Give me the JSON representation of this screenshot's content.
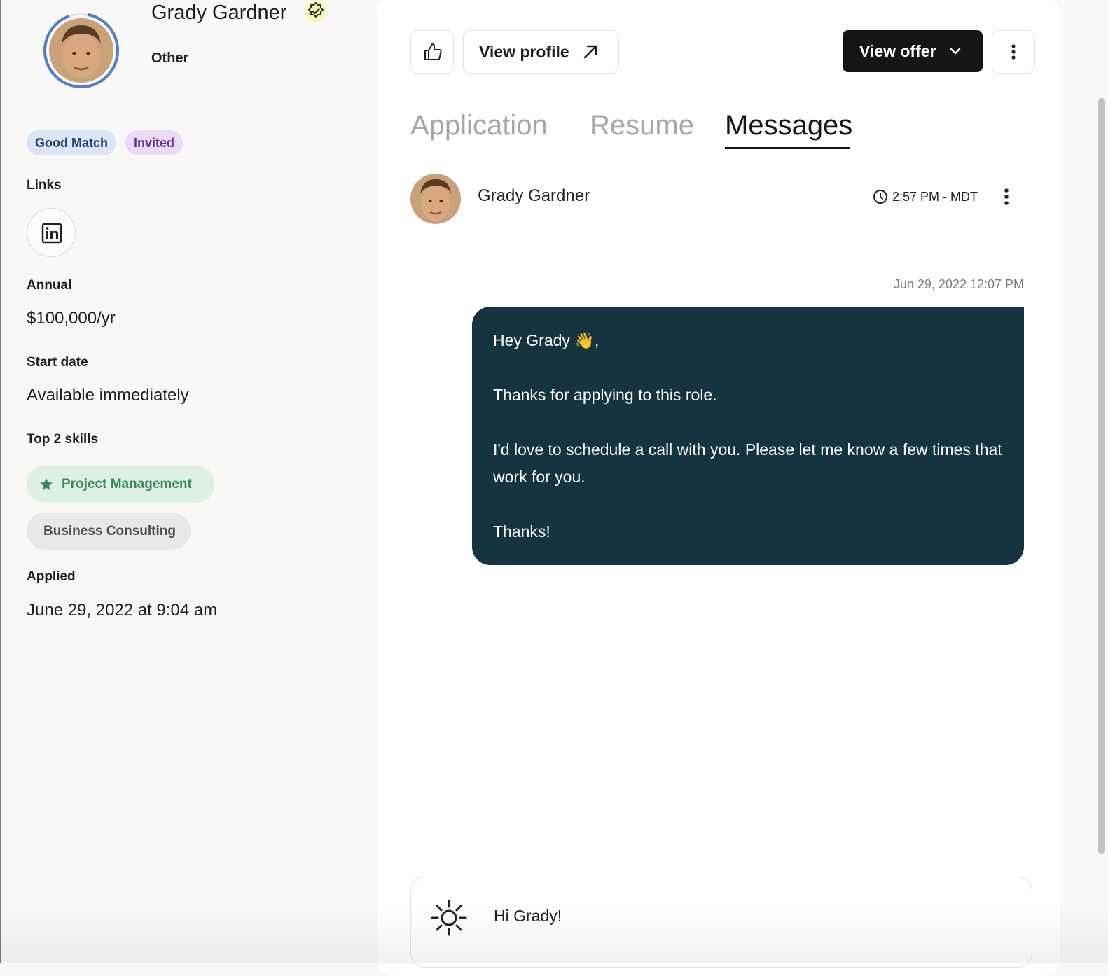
{
  "candidate": {
    "name": "Grady Gardner",
    "subtitle": "Other",
    "badges": [
      "Good Match",
      "Invited"
    ]
  },
  "sections": {
    "links_label": "Links",
    "annual_label": "Annual",
    "annual_value": "$100,000/yr",
    "start_label": "Start date",
    "start_value": "Available immediately",
    "skills_label": "Top 2 skills",
    "skills": [
      "Project Management",
      "Business Consulting"
    ],
    "applied_label": "Applied",
    "applied_value": "June 29, 2022 at 9:04 am"
  },
  "toolbar": {
    "view_profile": "View profile",
    "view_offer": "View offer"
  },
  "tabs": [
    "Application",
    "Resume",
    "Messages"
  ],
  "active_tab": "Messages",
  "thread": {
    "sender": "Grady Gardner",
    "time": "2:57 PM - MDT"
  },
  "message": {
    "date": "Jun 29, 2022 12:07 PM",
    "lines": [
      "Hey Grady 👋,",
      "Thanks for applying to this role.",
      "I'd love to schedule a call with you. Please let me know a few times that work for you.",
      "Thanks!"
    ]
  },
  "composer": {
    "value": "Hi Grady!"
  },
  "icons": {
    "verified": "verified-badge-icon",
    "linkedin": "linkedin-icon",
    "like": "thumbs-up-icon",
    "external": "arrow-up-right-icon",
    "dropdown": "chevron-down-icon",
    "more": "kebab-icon",
    "clock": "clock-icon",
    "star": "star-icon",
    "ai": "sparkle-gear-icon"
  },
  "colors": {
    "bubble": "#163440",
    "match_badge": "#dbe7f8",
    "invited_badge": "#eadcf7",
    "top_skill": "#dcf0e3",
    "primary_button": "#151515"
  }
}
